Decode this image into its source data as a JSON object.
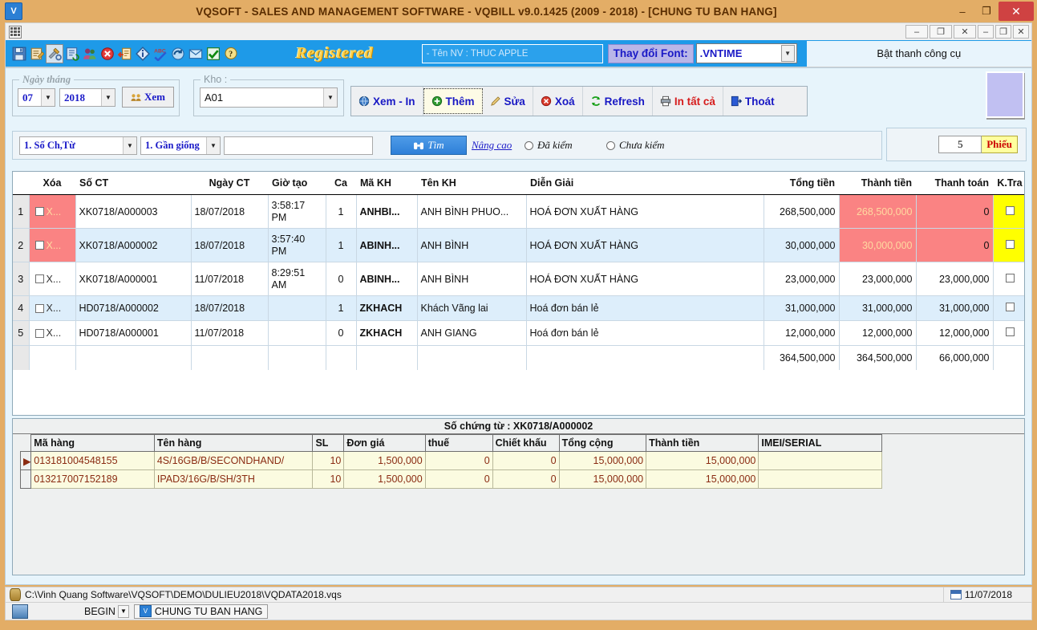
{
  "window": {
    "title": "VQSOFT - SALES AND MANAGEMENT SOFTWARE - VQBILL v9.0.1425 (2009 - 2018) - [CHUNG TU BAN HANG]",
    "app_icon": "V",
    "minimize": "–",
    "maximize": "❐",
    "close": "✕"
  },
  "mdi": {
    "minimize": "–",
    "restore": "❐",
    "close": "✕",
    "minimize2": "–",
    "restore2": "❐",
    "close2": "✕"
  },
  "toolbar": {
    "icons": [
      {
        "name": "save-icon",
        "glyph": "💾"
      },
      {
        "name": "wizard-icon",
        "glyph": "🔖"
      },
      {
        "name": "tools-icon",
        "glyph": "⚒"
      },
      {
        "name": "refresh-doc-icon",
        "glyph": "📘"
      },
      {
        "name": "users-icon",
        "glyph": "👥"
      },
      {
        "name": "delete-icon",
        "glyph": "⛔"
      },
      {
        "name": "import-icon",
        "glyph": "📑"
      },
      {
        "name": "info-icon",
        "glyph": "◈"
      },
      {
        "name": "spellcheck-icon",
        "glyph": "✔"
      },
      {
        "name": "sync-icon",
        "glyph": "🔄"
      },
      {
        "name": "mail-icon",
        "glyph": "✉"
      },
      {
        "name": "check-icon",
        "glyph": "☑"
      },
      {
        "name": "help-icon",
        "glyph": "❓"
      }
    ],
    "registered_label": "Registered",
    "employee_field": "- Tên NV : THUC APPLE",
    "font_change_label": "Thay đổi Font:",
    "font_value": ".VNTIME",
    "show_toolbar_label": "Bật thanh công cụ"
  },
  "filters": {
    "date_group_title": "Ngày tháng",
    "month": "07",
    "year": "2018",
    "view_button": "Xem",
    "warehouse_group_title": "Kho :",
    "warehouse": "A01"
  },
  "actions": [
    {
      "name": "view-print",
      "label": "Xem - In",
      "icon": "globe-icon",
      "color": "blue",
      "focused": false
    },
    {
      "name": "add",
      "label": "Thêm",
      "icon": "plus-circle-icon",
      "color": "blue",
      "focused": true
    },
    {
      "name": "edit",
      "label": "Sửa",
      "icon": "pencil-icon",
      "color": "blue",
      "focused": false
    },
    {
      "name": "delete",
      "label": "Xoá",
      "icon": "delete-circle-icon",
      "color": "blue",
      "focused": false
    },
    {
      "name": "refresh",
      "label": "Refresh",
      "icon": "refresh-icon",
      "color": "blue",
      "focused": false
    },
    {
      "name": "print-all",
      "label": "In tất cả",
      "icon": "printer-icon",
      "color": "red",
      "focused": false
    },
    {
      "name": "exit",
      "label": "Thoát",
      "icon": "exit-door-icon",
      "color": "blue",
      "focused": false
    }
  ],
  "search": {
    "field_select": "1. Số Ch,Từ",
    "match_select": "1. Gần giống",
    "query_value": "",
    "query_placeholder": "",
    "find_button": "Tìm",
    "advanced_link": "Nâng cao",
    "radio_checked_label": "Đã kiểm",
    "radio_unchecked_label": "Chưa  kiểm",
    "count_value": "5",
    "count_label": "Phiếu"
  },
  "grid": {
    "headers": [
      "",
      "Xóa",
      "Số CT",
      "Ngày CT",
      "Giờ tạo",
      "Ca",
      "Mã KH",
      "Tên KH",
      "Diễn Giải",
      "Tổng tiền",
      "Thành tiền",
      "Thanh toán",
      "K.Tra"
    ],
    "rows": [
      {
        "num": "1",
        "del_text": "X...",
        "del_hot": true,
        "so_ct": "XK0718/A000003",
        "ngay_ct": "18/07/2018",
        "gio_tao": "3:58:17 PM",
        "ca": "1",
        "ma_kh": "ANHBI...",
        "ten_kh": "ANH BÌNH PHUO...",
        "dien_giai": "HOÁ ĐƠN XUẤT HÀNG",
        "tong_tien": "268,500,000",
        "thanh_tien": "268,500,000",
        "thanh_toan": "0",
        "thanh_tien_hot": true,
        "thanh_toan_hot": true,
        "ktra_hot": true
      },
      {
        "num": "2",
        "del_text": "X...",
        "del_hot": true,
        "so_ct": "XK0718/A000002",
        "ngay_ct": "18/07/2018",
        "gio_tao": "3:57:40 PM",
        "ca": "1",
        "ma_kh": "ABINH...",
        "ten_kh": "ANH BÌNH",
        "dien_giai": "HOÁ ĐƠN XUẤT HÀNG",
        "tong_tien": "30,000,000",
        "thanh_tien": "30,000,000",
        "thanh_toan": "0",
        "thanh_tien_hot": true,
        "thanh_toan_hot": true,
        "ktra_hot": true
      },
      {
        "num": "3",
        "del_text": "X...",
        "del_hot": false,
        "so_ct": "XK0718/A000001",
        "ngay_ct": "11/07/2018",
        "gio_tao": "8:29:51 AM",
        "ca": "0",
        "ma_kh": "ABINH...",
        "ten_kh": "ANH BÌNH",
        "dien_giai": "HOÁ ĐƠN XUẤT HÀNG",
        "tong_tien": "23,000,000",
        "thanh_tien": "23,000,000",
        "thanh_toan": "23,000,000",
        "thanh_tien_hot": false,
        "thanh_toan_hot": false,
        "ktra_hot": false
      },
      {
        "num": "4",
        "del_text": "X...",
        "del_hot": false,
        "so_ct": "HD0718/A000002",
        "ngay_ct": "18/07/2018",
        "gio_tao": "",
        "ca": "1",
        "ma_kh": "ZKHACH",
        "ten_kh": " Khách Vãng lai",
        "dien_giai": "Hoá đơn bán lẻ",
        "tong_tien": "31,000,000",
        "thanh_tien": "31,000,000",
        "thanh_toan": "31,000,000",
        "thanh_tien_hot": false,
        "thanh_toan_hot": false,
        "ktra_hot": false
      },
      {
        "num": "5",
        "del_text": "X...",
        "del_hot": false,
        "so_ct": "HD0718/A000001",
        "ngay_ct": "11/07/2018",
        "gio_tao": "",
        "ca": "0",
        "ma_kh": "ZKHACH",
        "ten_kh": "ANH GIANG",
        "dien_giai": "Hoá đơn bán lẻ",
        "tong_tien": "12,000,000",
        "thanh_tien": "12,000,000",
        "thanh_toan": "12,000,000",
        "thanh_tien_hot": false,
        "thanh_toan_hot": false,
        "ktra_hot": false
      }
    ],
    "totals": {
      "tong_tien": "364,500,000",
      "thanh_tien": "364,500,000",
      "thanh_toan": "66,000,000"
    }
  },
  "detail": {
    "title": "Số chứng từ : XK0718/A000002",
    "headers": [
      "Mã hàng",
      "Tên hàng",
      "SL",
      "Đơn giá",
      "thuế",
      "Chiết khấu",
      "Tổng cộng",
      "Thành tiền",
      "IMEI/SERIAL"
    ],
    "rows": [
      {
        "marker": "▶",
        "ma_hang": "013181004548155",
        "ten_hang": "4S/16GB/B/SECONDHAND/",
        "sl": "10",
        "don_gia": "1,500,000",
        "thue": "0",
        "chiet_khau": "0",
        "tong_cong": "15,000,000",
        "thanh_tien": "15,000,000",
        "imei": ""
      },
      {
        "marker": "",
        "ma_hang": "013217007152189",
        "ten_hang": "IPAD3/16G/B/SH/3TH",
        "sl": "10",
        "don_gia": "1,500,000",
        "thue": "0",
        "chiet_khau": "0",
        "tong_cong": "15,000,000",
        "thanh_tien": "15,000,000",
        "imei": ""
      }
    ]
  },
  "status": {
    "db_path": "C:\\Vinh Quang Software\\VQSOFT\\DEMO\\DULIEU2018\\VQDATA2018.vqs",
    "date": "11/07/2018"
  },
  "taskbar": {
    "begin_label": "BEGIN",
    "tab_label": "CHUNG TU BAN HANG",
    "tab_icon": "V"
  },
  "colors": {
    "window_frame": "#e3ad66",
    "toolbar_blue": "#1e9ae8",
    "accent_blue": "#1818c4",
    "alert_red": "#fa8383",
    "highlight_yellow": "#ffff00",
    "detail_yellow": "#fbfbe0",
    "row_alt": "#ddeefb"
  }
}
